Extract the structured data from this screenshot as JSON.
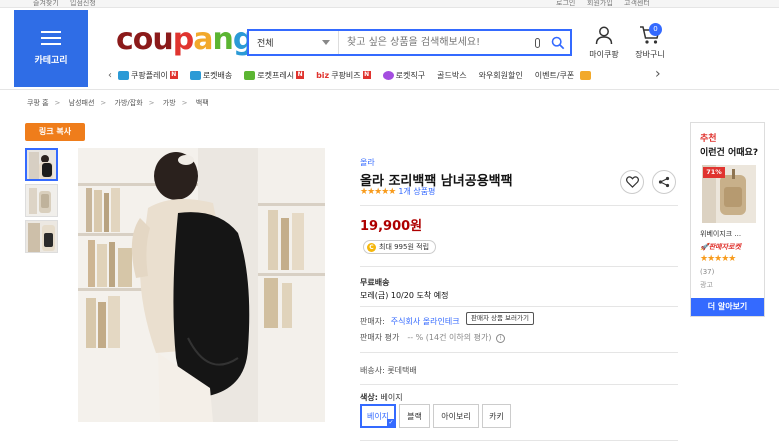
{
  "topbar": {
    "items": [
      "즐겨찾기",
      "입점신청",
      "로그인",
      "회원가입",
      "고객센터"
    ]
  },
  "header": {
    "category_label": "카테고리",
    "logo": {
      "c1": "cou",
      "c2": "p",
      "c3": "a",
      "c4": "n",
      "c5": "g"
    },
    "search": {
      "scope": "전체",
      "placeholder": "찾고 싶은 상품을 검색해보세요!"
    },
    "my_label": "마이쿠팡",
    "cart_label": "장바구니",
    "cart_count": "0"
  },
  "nav": {
    "items": [
      {
        "label": "쿠팡플레이",
        "icon_color": "#2b9ad6",
        "new": "N"
      },
      {
        "label": "로켓배송",
        "icon_color": "#2b9ad6"
      },
      {
        "label": "로켓프레시",
        "icon_color": "#5bb532",
        "new": "N"
      },
      {
        "label": "쿠팡비즈",
        "prefix": "biz",
        "new": "N"
      },
      {
        "label": "로켓직구",
        "icon_color": "#a44de0"
      },
      {
        "label": "골드박스"
      },
      {
        "label": "와우회원할인"
      },
      {
        "label": "이벤트/쿠폰"
      }
    ]
  },
  "breadcrumb": [
    "쿠팡 홈",
    "남성패션",
    "가방/잡화",
    "가방",
    "백팩"
  ],
  "link_copy": "링크 복사",
  "product": {
    "brand": "올라",
    "title": "올라 조리백팩 남녀공용백팩",
    "stars": "★★★★★",
    "review_count": "1개 상품평",
    "price": "19,900원",
    "cashback": "최대 995원 적립",
    "shipping_title": "무료배송",
    "shipping_eta": "모레(금) 10/20 도착 예정",
    "seller_label": "판매자:",
    "seller_name": "주식회사 올라인테크",
    "seller_tip": "판매자 상품 보러가기",
    "seller_rate_label": "판매자 평가",
    "seller_rate_value": "-- % (14건 이하의 평가)",
    "delivery": "배송사: 롯데택배",
    "color_label": "색상:",
    "color_value": "베이지",
    "options": [
      "베이지",
      "블랙",
      "아이보리",
      "카키"
    ]
  },
  "recommend": {
    "title1": "추천",
    "title2": "이런건 어때요?",
    "discount": "71%",
    "name": "위베이지크 ...",
    "rocket": "판매자로켓",
    "stars": "★★★★★",
    "count": "(37)",
    "ad": "광고",
    "more": "더 알아보기"
  },
  "colors": {
    "accent": "#346aff",
    "price": "#ae0000",
    "orange": "#ef7d1b",
    "star": "#f89b1c"
  }
}
